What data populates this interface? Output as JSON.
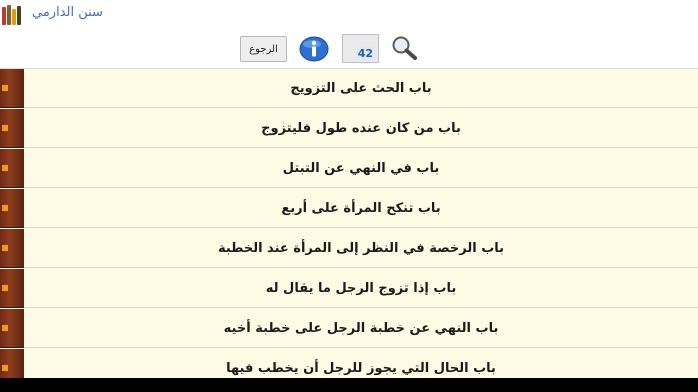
{
  "app": {
    "title": "سنن الدارمي"
  },
  "toolbar": {
    "back_label": "الرجوع",
    "count": "42"
  },
  "chapters": [
    "باب الحث على التزويج",
    "باب من كان عنده طول فليتزوج",
    "باب في النهي عن التبتل",
    "باب تنكح المرأة على أربع",
    "باب الرخصة في النظر إلى المرأة عند الخطبة",
    "باب إذا تزوج الرجل ما يقال له",
    "باب النهي عن خطبة الرجل على خطبة أخيه",
    "باب الحال التي يجوز للرجل أن يخطب فيها"
  ],
  "colors": {
    "background": "#fdfbe4",
    "accent": "#4a6fa5",
    "sidebar": "#7a3218"
  }
}
